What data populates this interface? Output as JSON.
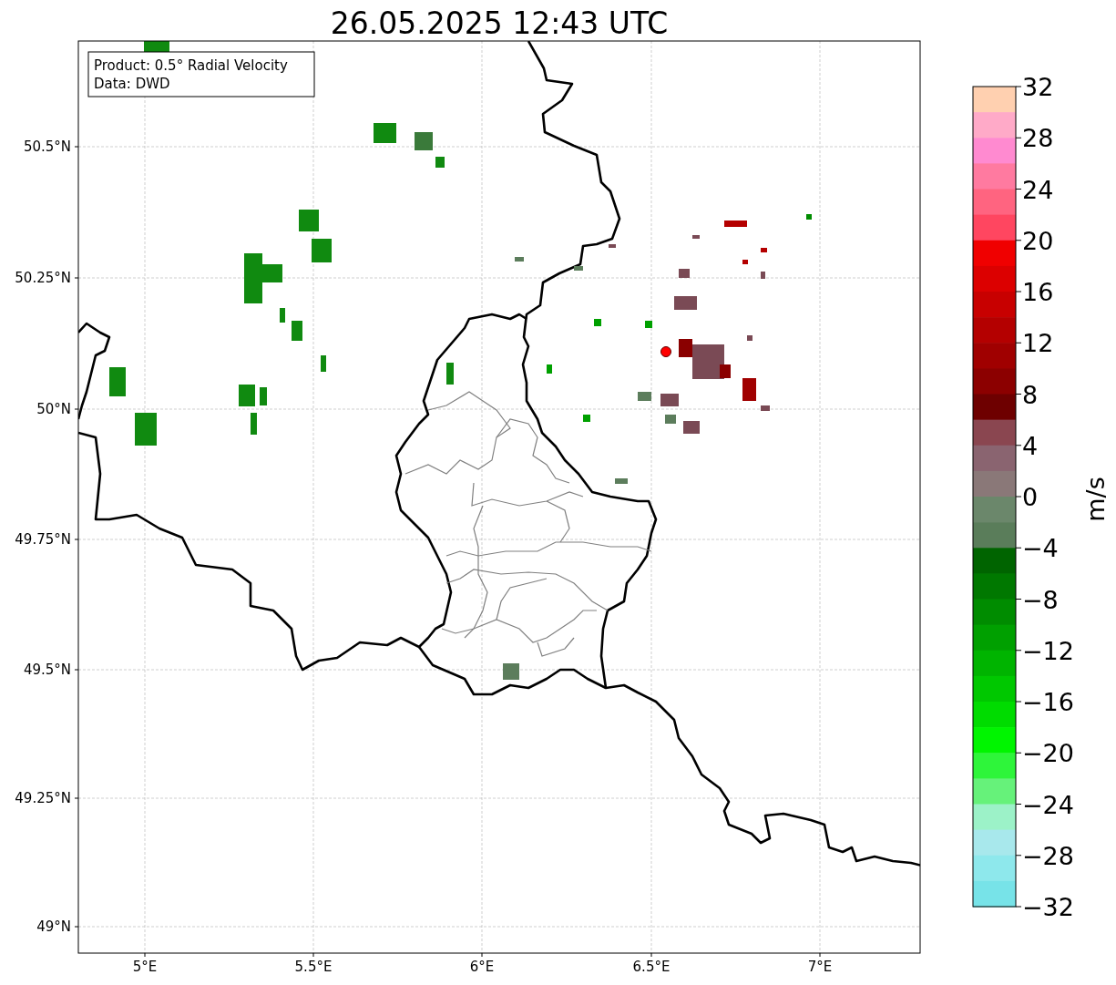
{
  "title": "26.05.2025 12:43 UTC",
  "info_box": {
    "lines": [
      "Product: 0.5° Radial Velocity",
      "Data: DWD"
    ]
  },
  "map": {
    "x_ticks": [
      "5°E",
      "5.5°E",
      "6°E",
      "6.5°E",
      "7°E"
    ],
    "y_ticks": [
      "50.5°N",
      "50.25°N",
      "50°N",
      "49.75°N",
      "49.5°N",
      "49.25°N",
      "49°N"
    ]
  },
  "colorbar": {
    "label": "m/s",
    "ticks": [
      "32",
      "28",
      "24",
      "20",
      "16",
      "12",
      "8",
      "4",
      "0",
      "−4",
      "−8",
      "−12",
      "−16",
      "−20",
      "−24",
      "−28",
      "−32"
    ],
    "bands": [
      {
        "color": "#ffd0b0"
      },
      {
        "color": "#ffaac8"
      },
      {
        "color": "#ff8ad0"
      },
      {
        "color": "#ff7aa0"
      },
      {
        "color": "#ff6480"
      },
      {
        "color": "#ff4660"
      },
      {
        "color": "#f00000"
      },
      {
        "color": "#dc0000"
      },
      {
        "color": "#c80000"
      },
      {
        "color": "#b40000"
      },
      {
        "color": "#a00000"
      },
      {
        "color": "#8c0000"
      },
      {
        "color": "#6e0000"
      },
      {
        "color": "#8a4650"
      },
      {
        "color": "#8a6470"
      },
      {
        "color": "#8a7878"
      },
      {
        "color": "#6b876b"
      },
      {
        "color": "#5a7d5a"
      },
      {
        "color": "#006400"
      },
      {
        "color": "#007800"
      },
      {
        "color": "#008c00"
      },
      {
        "color": "#00a000"
      },
      {
        "color": "#00b400"
      },
      {
        "color": "#00c800"
      },
      {
        "color": "#00dc00"
      },
      {
        "color": "#00f500"
      },
      {
        "color": "#2ef53a"
      },
      {
        "color": "#66f27a"
      },
      {
        "color": "#9cf2c8"
      },
      {
        "color": "#a8e8ec"
      },
      {
        "color": "#8ee8ec"
      },
      {
        "color": "#77e3e8"
      }
    ]
  }
}
